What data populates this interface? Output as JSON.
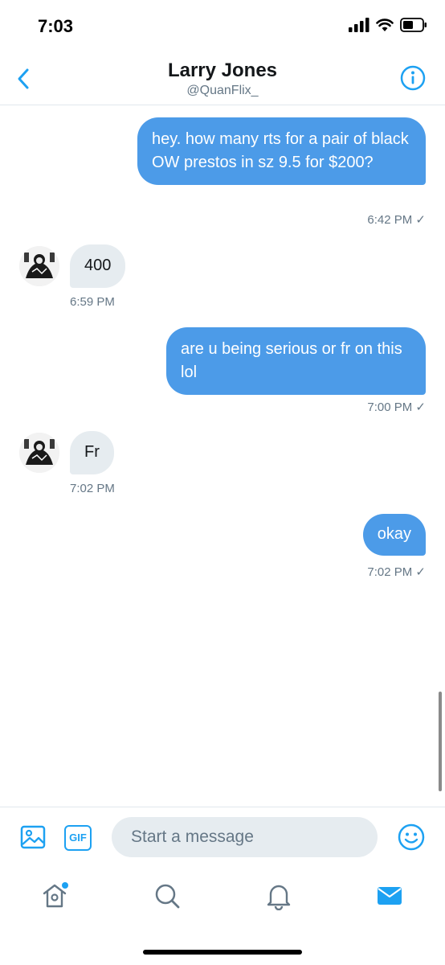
{
  "status_bar": {
    "time": "7:03"
  },
  "header": {
    "title": "Larry Jones",
    "handle": "@QuanFlix_"
  },
  "messages": [
    {
      "direction": "sent",
      "text": "hey. how many rts for a pair of black OW prestos in sz 9.5 for $200?",
      "time": "6:42 PM ✓"
    },
    {
      "direction": "received",
      "text": "400",
      "time": "6:59 PM"
    },
    {
      "direction": "sent",
      "text": "are u being serious or fr on this lol",
      "time": "7:00 PM ✓"
    },
    {
      "direction": "received",
      "text": "Fr",
      "time": "7:02 PM"
    },
    {
      "direction": "sent",
      "text": "okay",
      "time": "7:02 PM ✓"
    }
  ],
  "composer": {
    "gif_label": "GIF",
    "placeholder": "Start a message"
  },
  "tabs": [
    "home",
    "search",
    "notifications",
    "messages"
  ],
  "colors": {
    "accent": "#1da1f2",
    "sent_bubble": "#4c9be8",
    "received_bubble": "#e6ecf0",
    "secondary_text": "#657786"
  }
}
